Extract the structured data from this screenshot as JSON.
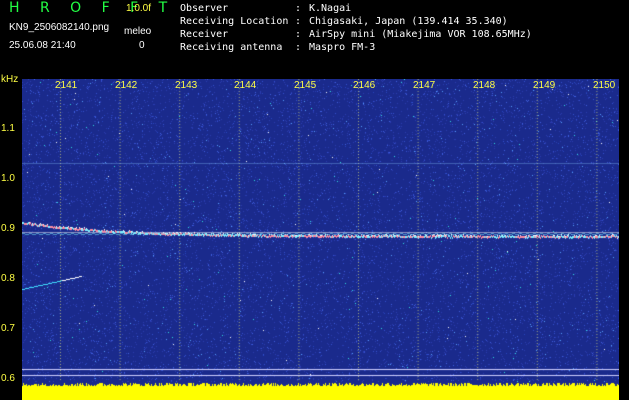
{
  "header": {
    "title": "H R O F F T",
    "version": "1.0.0f",
    "filename": "KN9_2506082140.png",
    "datetime": "25.06.08 21:40",
    "meleo_label": "meleo",
    "meleo_value": "0"
  },
  "meta": [
    {
      "key": "Observer",
      "value": "K.Nagai"
    },
    {
      "key": "Receiving Location",
      "value": "Chigasaki, Japan (139.414 35.340)"
    },
    {
      "key": "Receiver",
      "value": "AirSpy mini (Miakejima VOR 108.65MHz)"
    },
    {
      "key": "Receiving antenna",
      "value": "Maspro FM-3"
    }
  ],
  "axis": {
    "y_unit": "kHz",
    "x_ticks": [
      "2141",
      "2142",
      "2143",
      "2144",
      "2145",
      "2146",
      "2147",
      "2148",
      "2149",
      "2150"
    ],
    "y_ticks": [
      "1.1",
      "1.0",
      "0.9",
      "0.8",
      "0.7",
      "0.6"
    ]
  },
  "colors": {
    "background": "#1a2a8c",
    "signal": "#ffff00",
    "accent": "#22ff44",
    "labels": "#ffff44"
  }
}
